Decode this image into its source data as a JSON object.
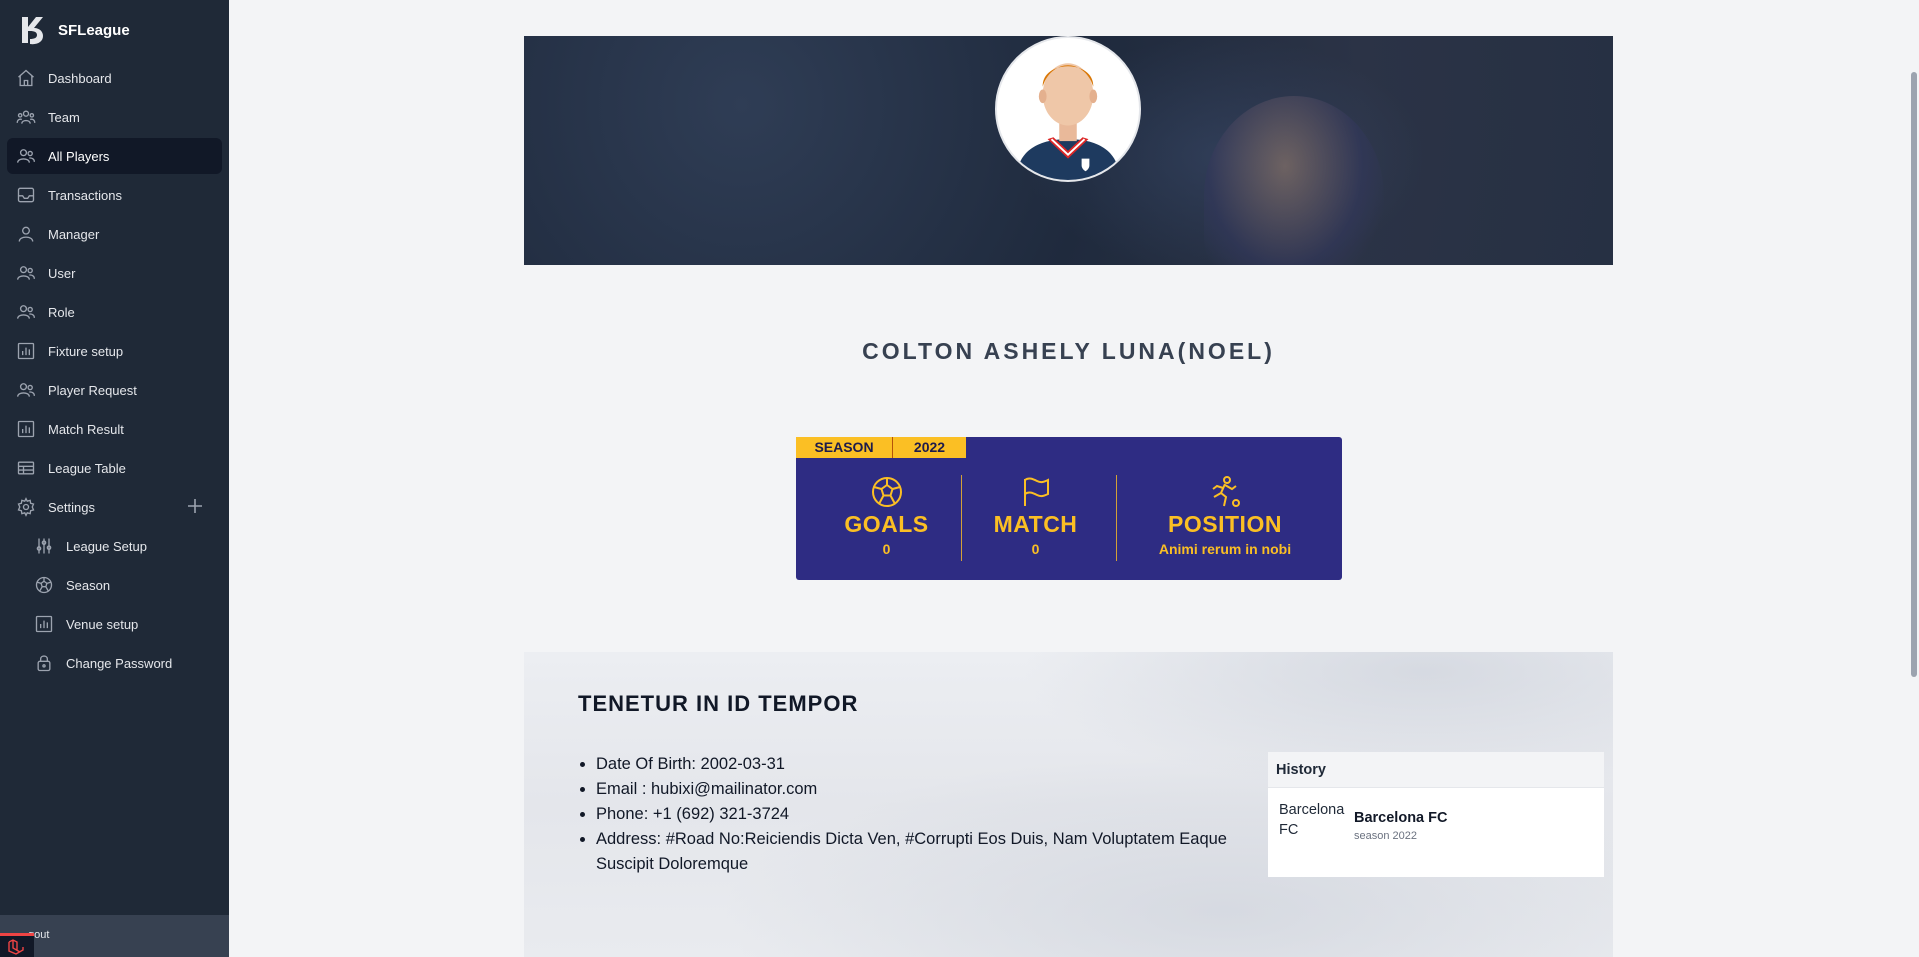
{
  "app": {
    "name": "SFLeague"
  },
  "sidebar": {
    "items": [
      {
        "label": "Dashboard",
        "icon": "home-icon"
      },
      {
        "label": "Team",
        "icon": "users-icon"
      },
      {
        "label": "All Players",
        "icon": "users-icon",
        "active": true
      },
      {
        "label": "Transactions",
        "icon": "inbox-icon"
      },
      {
        "label": "Manager",
        "icon": "user-icon"
      },
      {
        "label": "User",
        "icon": "users-icon"
      },
      {
        "label": "Role",
        "icon": "users-icon"
      },
      {
        "label": "Fixture setup",
        "icon": "chart-bar-icon"
      },
      {
        "label": "Player Request",
        "icon": "users-icon"
      },
      {
        "label": "Match Result",
        "icon": "chart-bar-icon"
      },
      {
        "label": "League Table",
        "icon": "table-icon"
      },
      {
        "label": "Settings",
        "icon": "gear-icon"
      }
    ],
    "settings_items": [
      {
        "label": "League Setup",
        "icon": "sliders-icon"
      },
      {
        "label": "Season",
        "icon": "soccer-ball-icon"
      },
      {
        "label": "Venue setup",
        "icon": "chart-bar-icon"
      },
      {
        "label": "Change Password",
        "icon": "lock-icon"
      }
    ],
    "footer_label": "gout"
  },
  "profile": {
    "name": "COLTON ASHELY LUNA(NOEL)"
  },
  "stats": {
    "season_label": "SEASON",
    "season_year": "2022",
    "goals_label": "GOALS",
    "goals_value": "0",
    "match_label": "MATCH",
    "match_value": "0",
    "position_label": "POSITION",
    "position_value": "Animi rerum in nobi",
    "accent_color": "#fbbf24",
    "card_color": "#2e2c83"
  },
  "details": {
    "title": "TENETUR IN ID TEMPOR",
    "info": [
      "Date Of Birth: 2002-03-31",
      "Email : hubixi@mailinator.com",
      "Phone: +1 (692) 321-3724",
      "Address: #Road No:Reiciendis Dicta Ven, #Corrupti Eos Duis, Nam Voluptatem Eaque Suscipit Doloremque"
    ]
  },
  "history": {
    "title": "History",
    "club_left": "Barcelona FC",
    "club_name": "Barcelona FC",
    "season": "season 2022"
  }
}
